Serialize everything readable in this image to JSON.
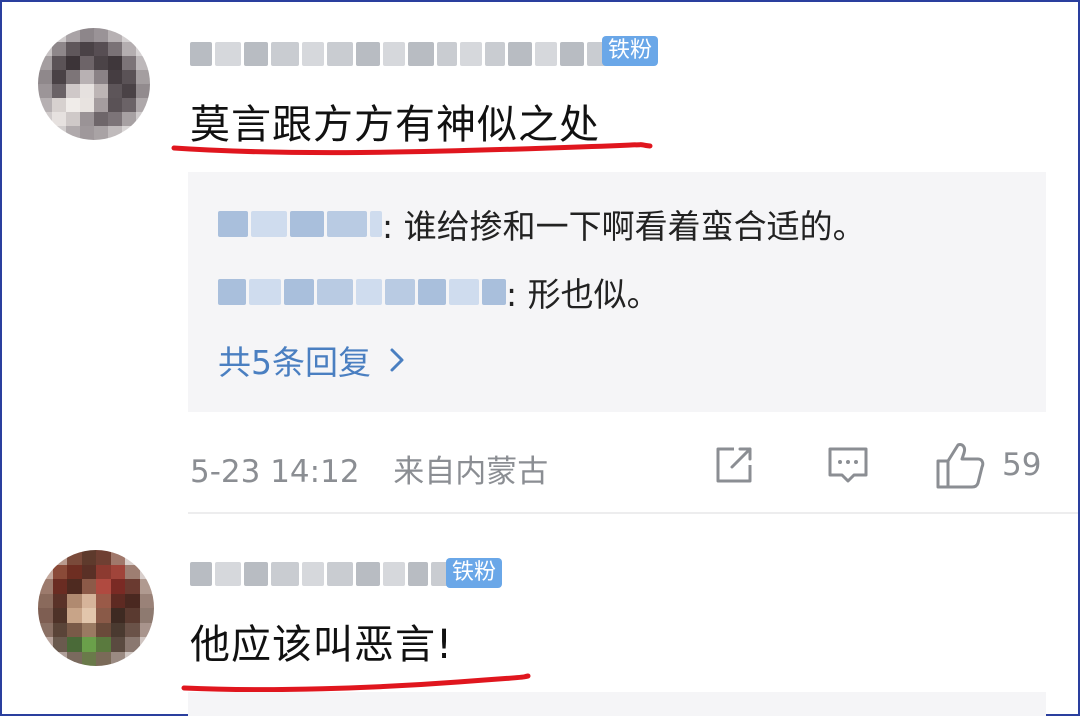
{
  "comments": [
    {
      "username": "█████",
      "badge": "铁粉",
      "text": "莫言跟方方有神似之处",
      "replies": [
        {
          "author": "████",
          "text": ": 谁给掺和一下啊看着蛮合适的。"
        },
        {
          "author": "██████",
          "text": ": 形也似。"
        }
      ],
      "more_replies": "共5条回复",
      "timestamp": "5-23 14:12",
      "location": "来自内蒙古",
      "like_count": "59",
      "underline_color": "#e0161e"
    },
    {
      "username": "█████",
      "badge": "铁粉",
      "text": "他应该叫恶言!",
      "underline_color": "#e0161e"
    }
  ],
  "colors": {
    "badge": "#6aa7e8",
    "link": "#4a7fc1",
    "meta": "#8b8e93",
    "reply_bg": "#f5f5f7"
  },
  "icons": [
    "share-icon",
    "comment-icon",
    "like-icon",
    "chevron-right-icon"
  ]
}
